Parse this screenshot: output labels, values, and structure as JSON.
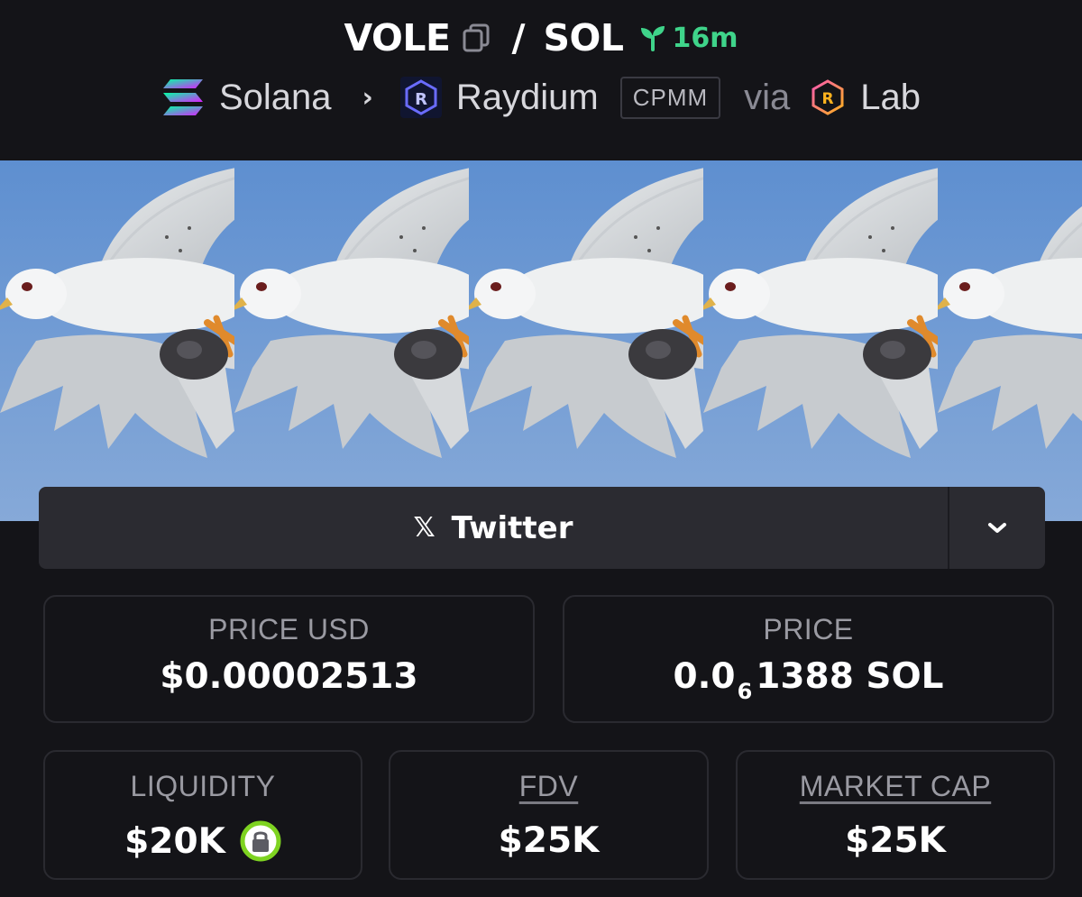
{
  "header": {
    "base_symbol": "VOLE",
    "separator": "/",
    "quote_symbol": "SOL",
    "pair_age": "16m",
    "breadcrumb": {
      "chain": "Solana",
      "dex": "Raydium",
      "pool_type": "CPMM",
      "via_label": "via",
      "launchpad": "Lab"
    }
  },
  "banner": {
    "tiles": 4
  },
  "social": {
    "primary_label": "Twitter",
    "x_glyph": "𝕏"
  },
  "stats": {
    "price_usd": {
      "label": "PRICE USD",
      "value": "$0.00002513"
    },
    "price": {
      "label": "PRICE",
      "value_prefix": "0.0",
      "value_zero_count": "6",
      "value_suffix": "1388 SOL"
    },
    "liquidity": {
      "label": "LIQUIDITY",
      "value": "$20K"
    },
    "fdv": {
      "label": "FDV",
      "value": "$25K"
    },
    "market_cap": {
      "label": "MARKET CAP",
      "value": "$25K"
    }
  },
  "colors": {
    "background": "#141418",
    "accent_green": "#3fd48a",
    "lock_green": "#7ed321",
    "card_border": "#2a2a30",
    "social_bar": "#2b2b31",
    "muted_text": "#9a9aa2"
  },
  "icons": {
    "copy": "copy-icon",
    "age": "seedling-icon",
    "chain": "solana-icon",
    "dex": "raydium-icon",
    "launchpad": "raydium-lab-icon",
    "social": "x-icon",
    "dropdown": "chevron-down-icon",
    "liquidity_lock": "lock-icon"
  }
}
